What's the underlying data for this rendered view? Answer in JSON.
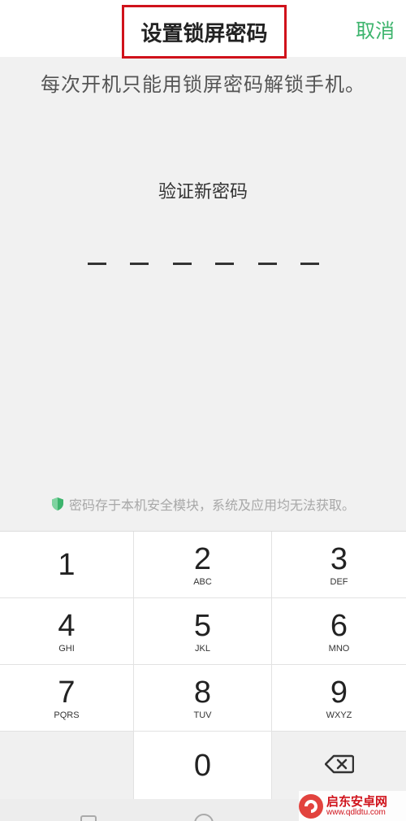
{
  "header": {
    "title": "设置锁屏密码",
    "cancel_label": "取消"
  },
  "hint": "每次开机只能用锁屏密码解锁手机。",
  "verify_label": "验证新密码",
  "pin_length": 6,
  "security_note": "密码存于本机安全模块，系统及应用均无法获取。",
  "keypad": {
    "keys": [
      {
        "num": "1",
        "letters": ""
      },
      {
        "num": "2",
        "letters": "ABC"
      },
      {
        "num": "3",
        "letters": "DEF"
      },
      {
        "num": "4",
        "letters": "GHI"
      },
      {
        "num": "5",
        "letters": "JKL"
      },
      {
        "num": "6",
        "letters": "MNO"
      },
      {
        "num": "7",
        "letters": "PQRS"
      },
      {
        "num": "8",
        "letters": "TUV"
      },
      {
        "num": "9",
        "letters": "WXYZ"
      },
      {
        "num": "0",
        "letters": ""
      }
    ],
    "delete_icon": "backspace-icon"
  },
  "colors": {
    "accent": "#3db46d",
    "highlight_border": "#d0121b",
    "background": "#f1f1f1"
  },
  "watermark": {
    "name": "启东安卓网",
    "url": "www.qdldtu.com"
  }
}
